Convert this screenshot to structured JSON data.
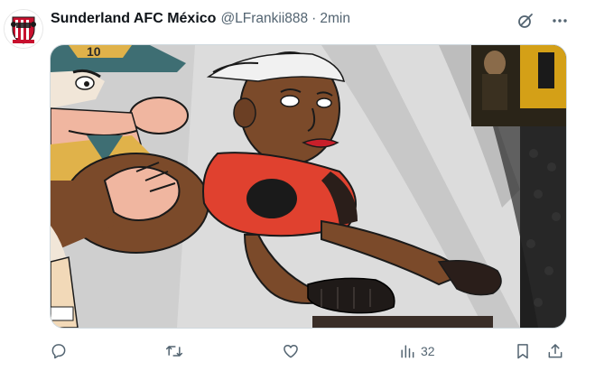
{
  "tweet": {
    "display_name": "Sunderland AFC México",
    "handle": "@LFrankii888",
    "separator": "·",
    "time": "2min"
  },
  "media": {
    "banner_number": "10"
  },
  "actions": {
    "reply_count": "",
    "retweet_count": "",
    "like_count": "",
    "views_count": "32"
  },
  "icons": {
    "top": [
      "grok-icon",
      "more-options-icon"
    ],
    "bottom": [
      "reply-icon",
      "retweet-icon",
      "like-icon",
      "views-icon",
      "bookmark-icon",
      "share-icon"
    ]
  },
  "colors": {
    "text_primary": "#0f1419",
    "text_secondary": "#536471",
    "crest_red": "#c8102e"
  }
}
